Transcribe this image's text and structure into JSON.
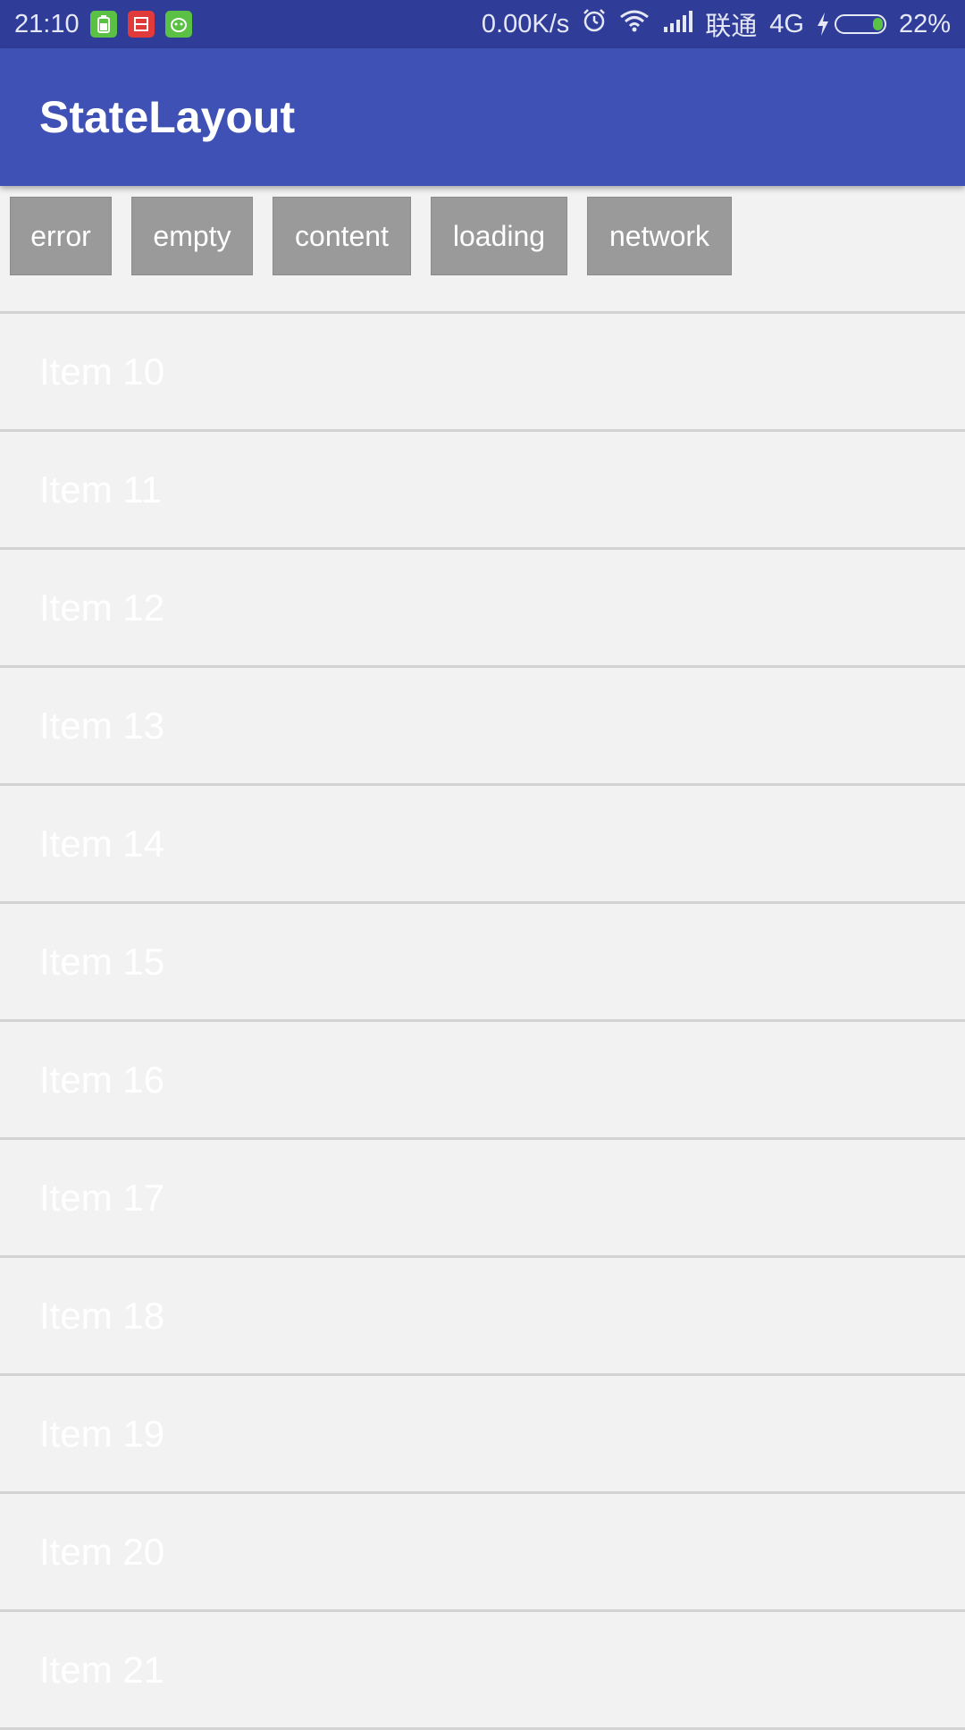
{
  "status_bar": {
    "time": "21:10",
    "net_speed": "0.00K/s",
    "carrier": "联通",
    "network_type": "4G",
    "battery": "22%",
    "icons": [
      "battery-app-icon",
      "shopping-app-icon",
      "android-app-icon",
      "alarm-icon",
      "wifi-icon",
      "signal-icon",
      "charging-icon",
      "battery-icon"
    ]
  },
  "toolbar": {
    "title": "StateLayout",
    "color": "#3f51b5"
  },
  "buttons": [
    {
      "label": "error"
    },
    {
      "label": "empty"
    },
    {
      "label": "content"
    },
    {
      "label": "loading"
    },
    {
      "label": "network"
    }
  ],
  "items": [
    {
      "label": "Item 10"
    },
    {
      "label": "Item 11"
    },
    {
      "label": "Item 12"
    },
    {
      "label": "Item 13"
    },
    {
      "label": "Item 14"
    },
    {
      "label": "Item 15"
    },
    {
      "label": "Item 16"
    },
    {
      "label": "Item 17"
    },
    {
      "label": "Item 18"
    },
    {
      "label": "Item 19"
    },
    {
      "label": "Item 20"
    },
    {
      "label": "Item 21"
    }
  ]
}
